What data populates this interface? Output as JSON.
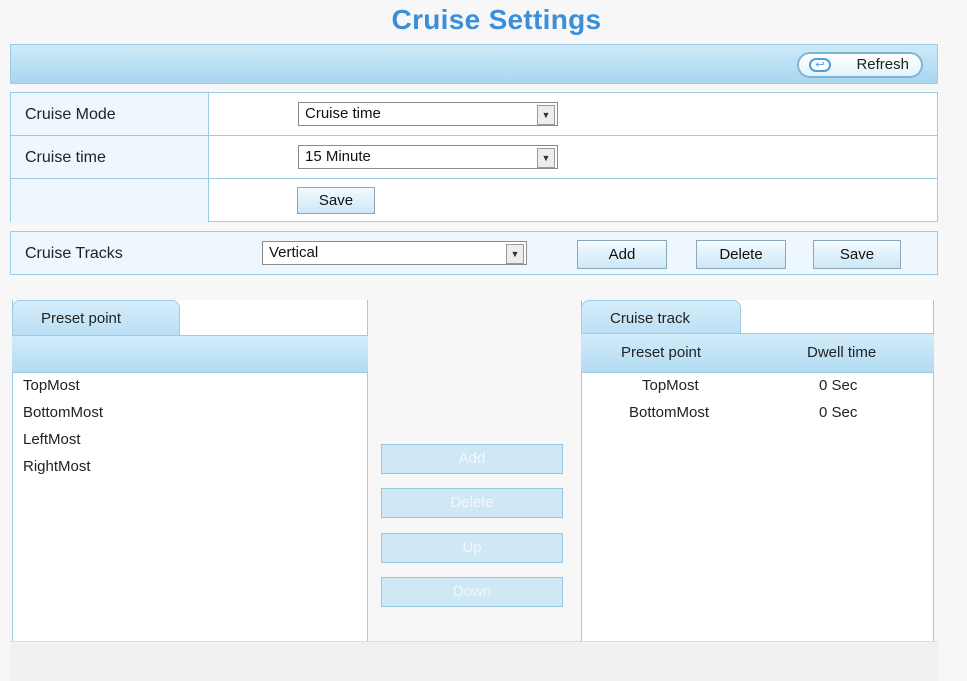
{
  "page": {
    "title": "Cruise Settings"
  },
  "toolbar": {
    "refresh_label": "Refresh"
  },
  "form": {
    "cruise_mode": {
      "label": "Cruise Mode",
      "value": "Cruise time"
    },
    "cruise_time": {
      "label": "Cruise time",
      "value": "15 Minute"
    },
    "save_label": "Save"
  },
  "tracks": {
    "label": "Cruise Tracks",
    "value": "Vertical",
    "add_label": "Add",
    "delete_label": "Delete",
    "save_label": "Save"
  },
  "preset_panel": {
    "tab_label": "Preset point",
    "items": [
      "TopMost",
      "BottomMost",
      "LeftMost",
      "RightMost"
    ]
  },
  "middle_buttons": {
    "add": "Add",
    "delete": "Delete",
    "up": "Up",
    "down": "Down"
  },
  "cruise_track_panel": {
    "tab_label": "Cruise track",
    "col_preset": "Preset point",
    "col_dwell": "Dwell time",
    "rows": [
      {
        "preset": "TopMost",
        "dwell": "0 Sec"
      },
      {
        "preset": "BottomMost",
        "dwell": "0 Sec"
      }
    ]
  }
}
